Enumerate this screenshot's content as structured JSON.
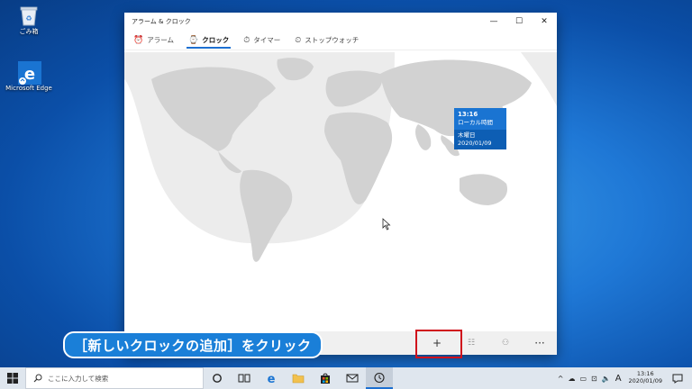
{
  "desktop": {
    "icons": [
      {
        "label": "ごみ箱",
        "icon": "recycle-bin-icon"
      },
      {
        "label": "Microsoft Edge",
        "icon": "edge-icon"
      }
    ]
  },
  "window": {
    "title": "アラーム & クロック",
    "controls": {
      "minimize": "—",
      "maximize": "☐",
      "close": "✕"
    },
    "tabs": [
      {
        "label": "アラーム",
        "icon": "⏰",
        "active": false
      },
      {
        "label": "クロック",
        "icon": "⌚",
        "active": true
      },
      {
        "label": "タイマー",
        "icon": "⏱",
        "active": false
      },
      {
        "label": "ストップウォッチ",
        "icon": "⏲",
        "active": false
      }
    ],
    "clock_tooltip": {
      "time": "13:16",
      "zone": "ローカル時間",
      "weekday": "木曜日",
      "date": "2020/01/09"
    },
    "appbar": {
      "add": "+",
      "select": "☷",
      "compare": "⚇",
      "more": "···"
    }
  },
  "caption": "［新しいクロックの追加］をクリック",
  "taskbar": {
    "search_placeholder": "ここに入力して検索",
    "tray_ime": "A",
    "time": "13:16",
    "date": "2020/01/09"
  },
  "colors": {
    "accent": "#1a74d2",
    "highlight": "#d0101c",
    "map_land": "#d2d2d2",
    "map_night": "#ebebeb"
  }
}
